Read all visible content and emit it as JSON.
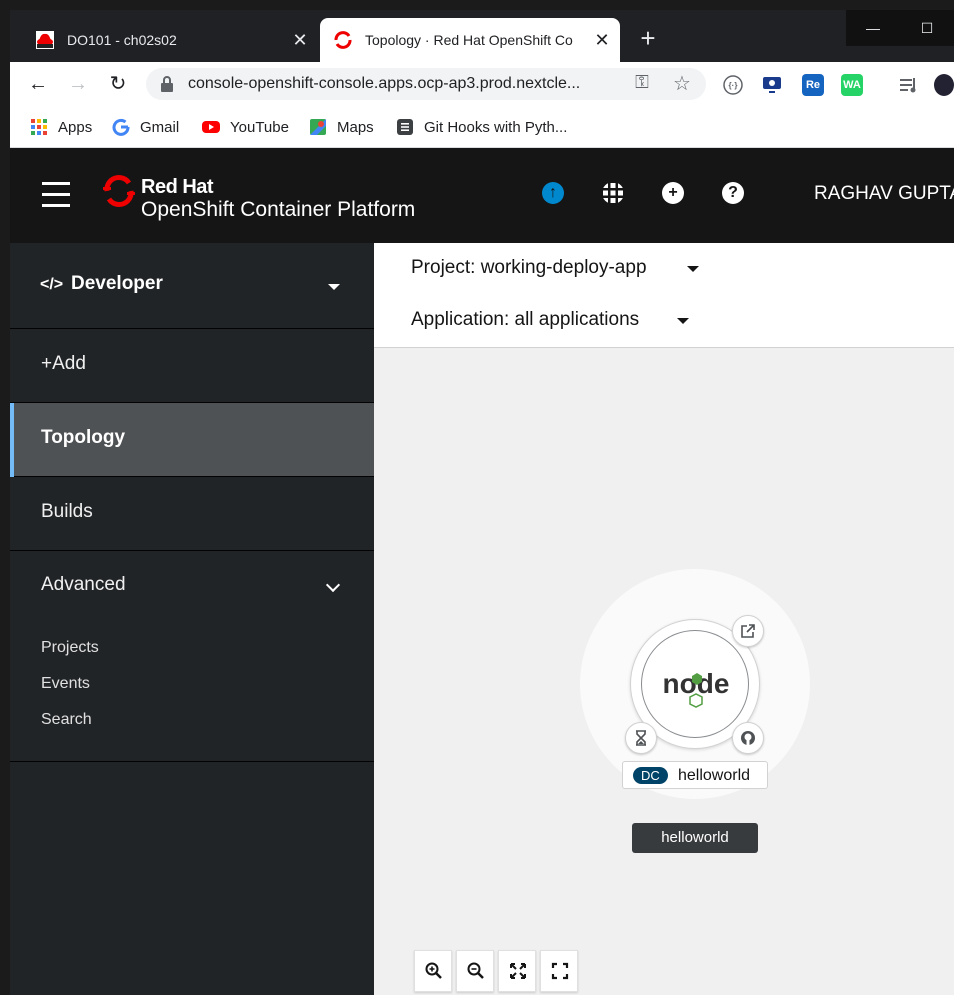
{
  "browser": {
    "tabs": [
      {
        "title": "DO101 - ch02s02",
        "close": "✕"
      },
      {
        "title": "Topology · Red Hat OpenShift Co",
        "close": "✕"
      }
    ],
    "new_tab": "+",
    "url": "console-openshift-console.apps.ocp-ap3.prod.nextcle...",
    "extensions": [
      "Re",
      "WA"
    ]
  },
  "bookmarks": [
    {
      "label": "Apps",
      "icon": "apps-grid-icon"
    },
    {
      "label": "Gmail",
      "icon": "google-icon"
    },
    {
      "label": "YouTube",
      "icon": "youtube-icon"
    },
    {
      "label": "Maps",
      "icon": "maps-icon"
    },
    {
      "label": "Git Hooks with Pyth...",
      "icon": "document-icon"
    }
  ],
  "masthead": {
    "brand_line1": "Red Hat",
    "brand_line2": "OpenShift Container Platform",
    "user": "RAGHAV GUPTA"
  },
  "sidebar": {
    "perspective": {
      "icon_text": "</>",
      "label": "Developer"
    },
    "items": [
      {
        "label": "+Add"
      },
      {
        "label": "Topology",
        "active": true
      },
      {
        "label": "Builds"
      }
    ],
    "advanced": {
      "label": "Advanced",
      "children": [
        "Projects",
        "Events",
        "Search"
      ]
    }
  },
  "main": {
    "project": "Project: working-deploy-app",
    "application": "Application: all applications",
    "node": {
      "type_badge": "DC",
      "name": "helloworld",
      "group_label": "helloworld",
      "logo_text": "node"
    }
  },
  "colors": {
    "masthead": "#151515",
    "sidebar": "#212427",
    "active_nav": "#4f5255",
    "active_indicator": "#73bcf7",
    "brand_red": "#ee0000",
    "dc_badge": "#004368"
  }
}
